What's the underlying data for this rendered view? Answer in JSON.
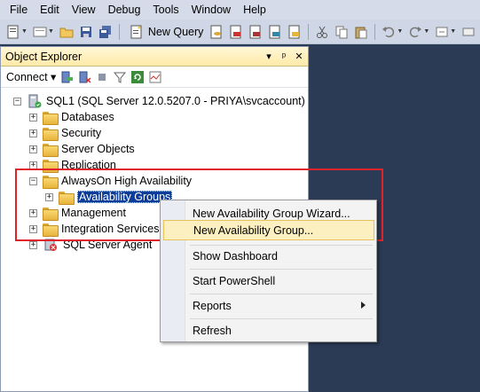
{
  "menubar": {
    "items": [
      "File",
      "Edit",
      "View",
      "Debug",
      "Tools",
      "Window",
      "Help"
    ]
  },
  "toolbar": {
    "new_query_label": "New Query"
  },
  "object_explorer": {
    "title": "Object Explorer",
    "title_controls": [
      "▾",
      "ᵖ",
      "✕"
    ],
    "connect_label": "Connect ▾",
    "server_node": "SQL1 (SQL Server 12.0.5207.0 - PRIYA\\svcaccount)",
    "tree": {
      "databases": "Databases",
      "security": "Security",
      "server_objects": "Server Objects",
      "replication": "Replication",
      "alwayson": "AlwaysOn High Availability",
      "availability_groups": "Availability Groups",
      "management": "Management",
      "integration_services": "Integration Services C",
      "sql_server_agent": "SQL Server Agent"
    }
  },
  "context_menu": {
    "items": [
      "New Availability Group Wizard...",
      "New Availability Group...",
      "Show Dashboard",
      "Start PowerShell",
      "Reports",
      "Refresh"
    ]
  },
  "colors": {
    "workspace": "#2b3a55",
    "selection": "#0c3c9a",
    "highlight_box": "#e0222a",
    "menu_hover": "#fcf0c0"
  }
}
